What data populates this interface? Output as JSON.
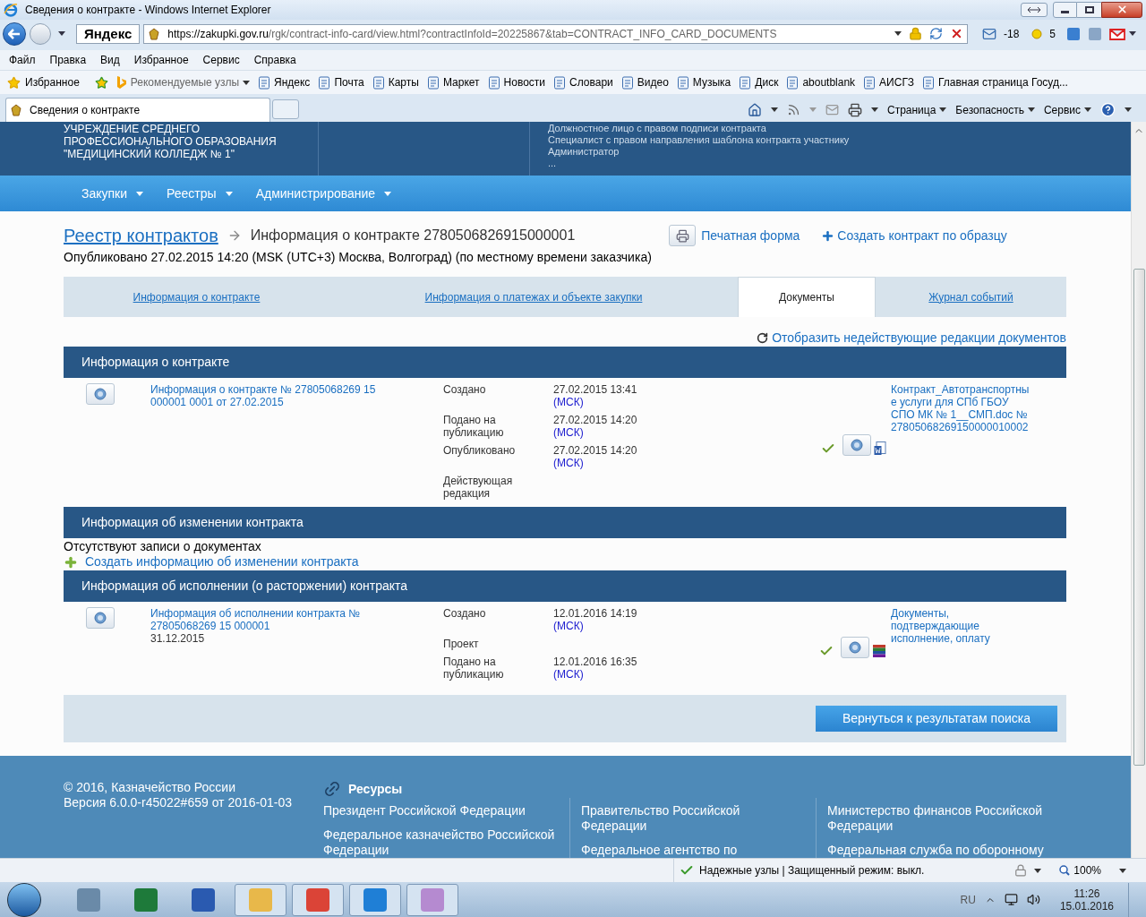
{
  "window": {
    "title": "Сведения о контракте - Windows Internet Explorer"
  },
  "address_bar": {
    "search_logo": "Яндекс",
    "url_host": "https://zakupki.gov.ru",
    "url_path": "/rgk/contract-info-card/view.html?contractInfoId=20225867&tab=CONTRACT_INFO_CARD_DOCUMENTS",
    "weather": "-18",
    "mail_count": "5"
  },
  "menu": [
    "Файл",
    "Правка",
    "Вид",
    "Избранное",
    "Сервис",
    "Справка"
  ],
  "favorites": {
    "label": "Избранное",
    "items": [
      {
        "label": "Рекомендуемые узлы",
        "kind": "dropdown"
      },
      {
        "label": "Яндекс",
        "kind": "link"
      },
      {
        "label": "Почта",
        "kind": "link"
      },
      {
        "label": "Карты",
        "kind": "link"
      },
      {
        "label": "Маркет",
        "kind": "link"
      },
      {
        "label": "Новости",
        "kind": "link"
      },
      {
        "label": "Словари",
        "kind": "link"
      },
      {
        "label": "Видео",
        "kind": "link"
      },
      {
        "label": "Музыка",
        "kind": "link"
      },
      {
        "label": "Диск",
        "kind": "link"
      },
      {
        "label": "aboutblank",
        "kind": "link"
      },
      {
        "label": "АИСГЗ",
        "kind": "link"
      },
      {
        "label": "Главная страница  Госуд...",
        "kind": "link"
      }
    ]
  },
  "browser_tab": {
    "title": "Сведения о контракте"
  },
  "command_bar": [
    "Страница",
    "Безопасность",
    "Сервис"
  ],
  "header": {
    "organization": [
      "УЧРЕЖДЕНИЕ СРЕДНЕГО",
      "ПРОФЕССИОНАЛЬНОГО ОБРАЗОВАНИЯ",
      "\"МЕДИЦИНСКИЙ КОЛЛЕДЖ № 1\""
    ],
    "roles": [
      "Должностное лицо с правом подписи контракта",
      "Специалист с правом направления шаблона контракта участнику",
      "Администратор",
      "..."
    ]
  },
  "nav": [
    "Закупки",
    "Реестры",
    "Администрирование"
  ],
  "breadcrumb": {
    "link": "Реестр контрактов",
    "current": "Информация о контракте 2780506826915000001"
  },
  "actions": {
    "print": "Печатная форма",
    "create": "Создать контракт по образцу"
  },
  "published": "Опубликовано 27.02.2015 14:20 (MSK (UTC+3) Москва, Волгоград) (по местному времени заказчика)",
  "tabs": [
    {
      "label": "Информация о контракте",
      "selected": false
    },
    {
      "label": "Информация о платежах и объекте закупки",
      "selected": false
    },
    {
      "label": "Документы",
      "selected": true
    },
    {
      "label": "Журнал событий",
      "selected": false
    }
  ],
  "show_inactive": "Отобразить недействующие редакции документов",
  "sections": [
    {
      "title": "Информация о контракте",
      "records": [
        {
          "title": "Информация о контракте № 27805068269 15 000001 0001 от 27.02.2015",
          "events": [
            {
              "label": "Создано",
              "value": "27.02.2015 13:41",
              "tz": "(МСК)"
            },
            {
              "label": "Подано на публикацию",
              "value": "27.02.2015 14:20",
              "tz": "(МСК)"
            },
            {
              "label": "Опубликовано",
              "value": "27.02.2015 14:20",
              "tz": "(МСК)"
            },
            {
              "label": "Действующая редакция"
            }
          ],
          "kind": "word",
          "file": "Контракт_Автотранспортные услуги для СПб ГБОУ СПО МК № 1__СМП.doc № 27805068269150000010002"
        }
      ]
    },
    {
      "title": "Информация об изменении контракта",
      "empty": "Отсутствуют записи о документах",
      "create": "Создать информацию об изменении контракта"
    },
    {
      "title": "Информация об исполнении (о расторжении) контракта",
      "records": [
        {
          "title": "Информация об исполнении контракта № 27805068269 15 000001",
          "date": "31.12.2015",
          "events": [
            {
              "label": "Создано",
              "value": "12.01.2016 14:19",
              "tz": "(МСК)"
            },
            {
              "label": "Проект"
            },
            {
              "label": "Подано на публикацию",
              "value": "12.01.2016 16:35",
              "tz": "(МСК)"
            }
          ],
          "kind": "archive",
          "file": "Документы, подтверждающие исполнение, оплату"
        }
      ]
    }
  ],
  "back_button": "Вернуться к результатам поиска",
  "footer": {
    "copyright": "© 2016, Казначейство России",
    "version": "Версия 6.0.0-r45022#659 от 2016-01-03",
    "resources_title": "Ресурсы",
    "columns": [
      [
        "Президент Российской Федерации",
        "Федеральное казначейство Российской Федерации"
      ],
      [
        "Правительство Российской Федерации",
        "Федеральное агентство по"
      ],
      [
        "Министерство финансов Российской Федерации",
        "Федеральная служба по оборонному"
      ]
    ]
  },
  "status_bar": {
    "text": "Надежные узлы | Защищенный режим: выкл.",
    "zoom": "100%"
  },
  "taskbar": {
    "language": "RU",
    "time": "11:26",
    "date": "15.01.2016"
  }
}
